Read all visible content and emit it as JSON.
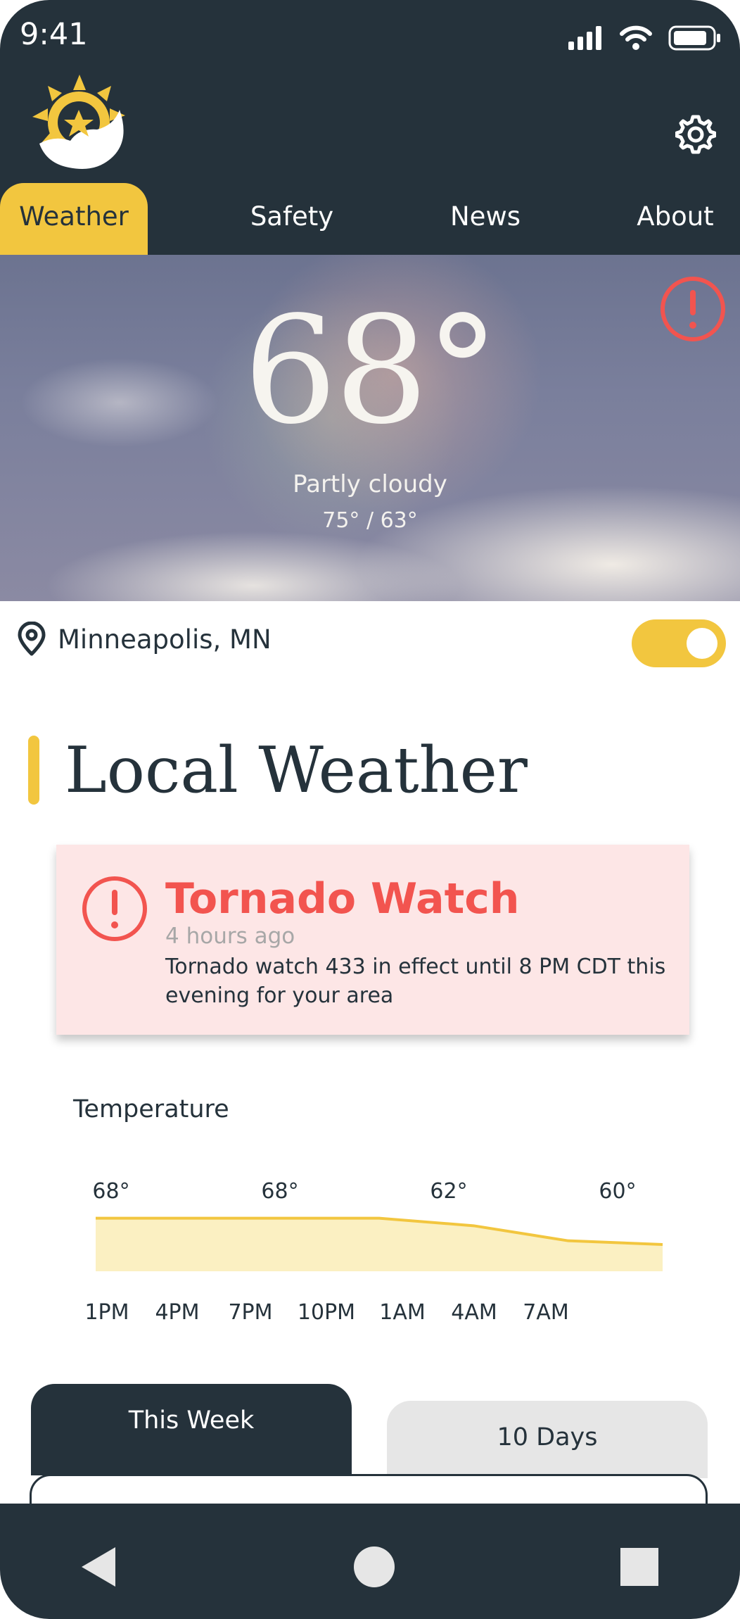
{
  "status_bar": {
    "time": "9:41",
    "icons": [
      "signal-icon",
      "wifi-icon",
      "battery-icon"
    ]
  },
  "header": {
    "logo": "sun-moon-star-logo",
    "settings_icon": "gear-icon",
    "tabs": [
      {
        "label": "Weather",
        "active": true
      },
      {
        "label": "Safety",
        "active": false
      },
      {
        "label": "News",
        "active": false
      },
      {
        "label": "About",
        "active": false
      }
    ]
  },
  "hero": {
    "temperature": "68°",
    "condition": "Partly cloudy",
    "range": "75° / 63°",
    "alert_icon": "exclamation-circle-icon"
  },
  "location": {
    "icon": "location-pin-icon",
    "name": "Minneapolis, MN",
    "toggle_on": true
  },
  "section": {
    "title": "Local Weather"
  },
  "alert": {
    "icon": "exclamation-circle-icon",
    "title": "Tornado Watch",
    "time": "4 hours ago",
    "body": "Tornado watch 433 in effect until 8 PM CDT this evening for your area"
  },
  "temperature_chart": {
    "title": "Temperature",
    "value_labels": [
      "68°",
      "68°",
      "62°",
      "60°"
    ],
    "time_labels": [
      "1PM",
      "4PM",
      "7PM",
      "10PM",
      "1AM",
      "4AM",
      "7AM"
    ]
  },
  "chart_data": {
    "type": "area",
    "title": "Temperature",
    "categories": [
      "1PM",
      "4PM",
      "7PM",
      "10PM",
      "1AM",
      "4AM",
      "7AM"
    ],
    "series": [
      {
        "values": [
          68,
          68,
          68,
          68,
          66,
          62,
          61
        ]
      }
    ],
    "labels_shown": [
      "68°",
      "68°",
      "62°",
      "60°"
    ],
    "ylim": [
      55,
      70
    ],
    "grid": false,
    "colors": {
      "line": "#f2c63f",
      "fill": "#fbf0c2"
    }
  },
  "forecast_tabs": [
    {
      "label": "This Week",
      "active": true
    },
    {
      "label": "10 Days",
      "active": false
    }
  ],
  "nav_bar": {
    "icons": [
      "back-icon",
      "home-icon",
      "recents-icon"
    ]
  },
  "colors": {
    "dark": "#25323b",
    "accent": "#f2c63f",
    "alert": "#f2544f",
    "alert_bg": "#fde6e6"
  }
}
